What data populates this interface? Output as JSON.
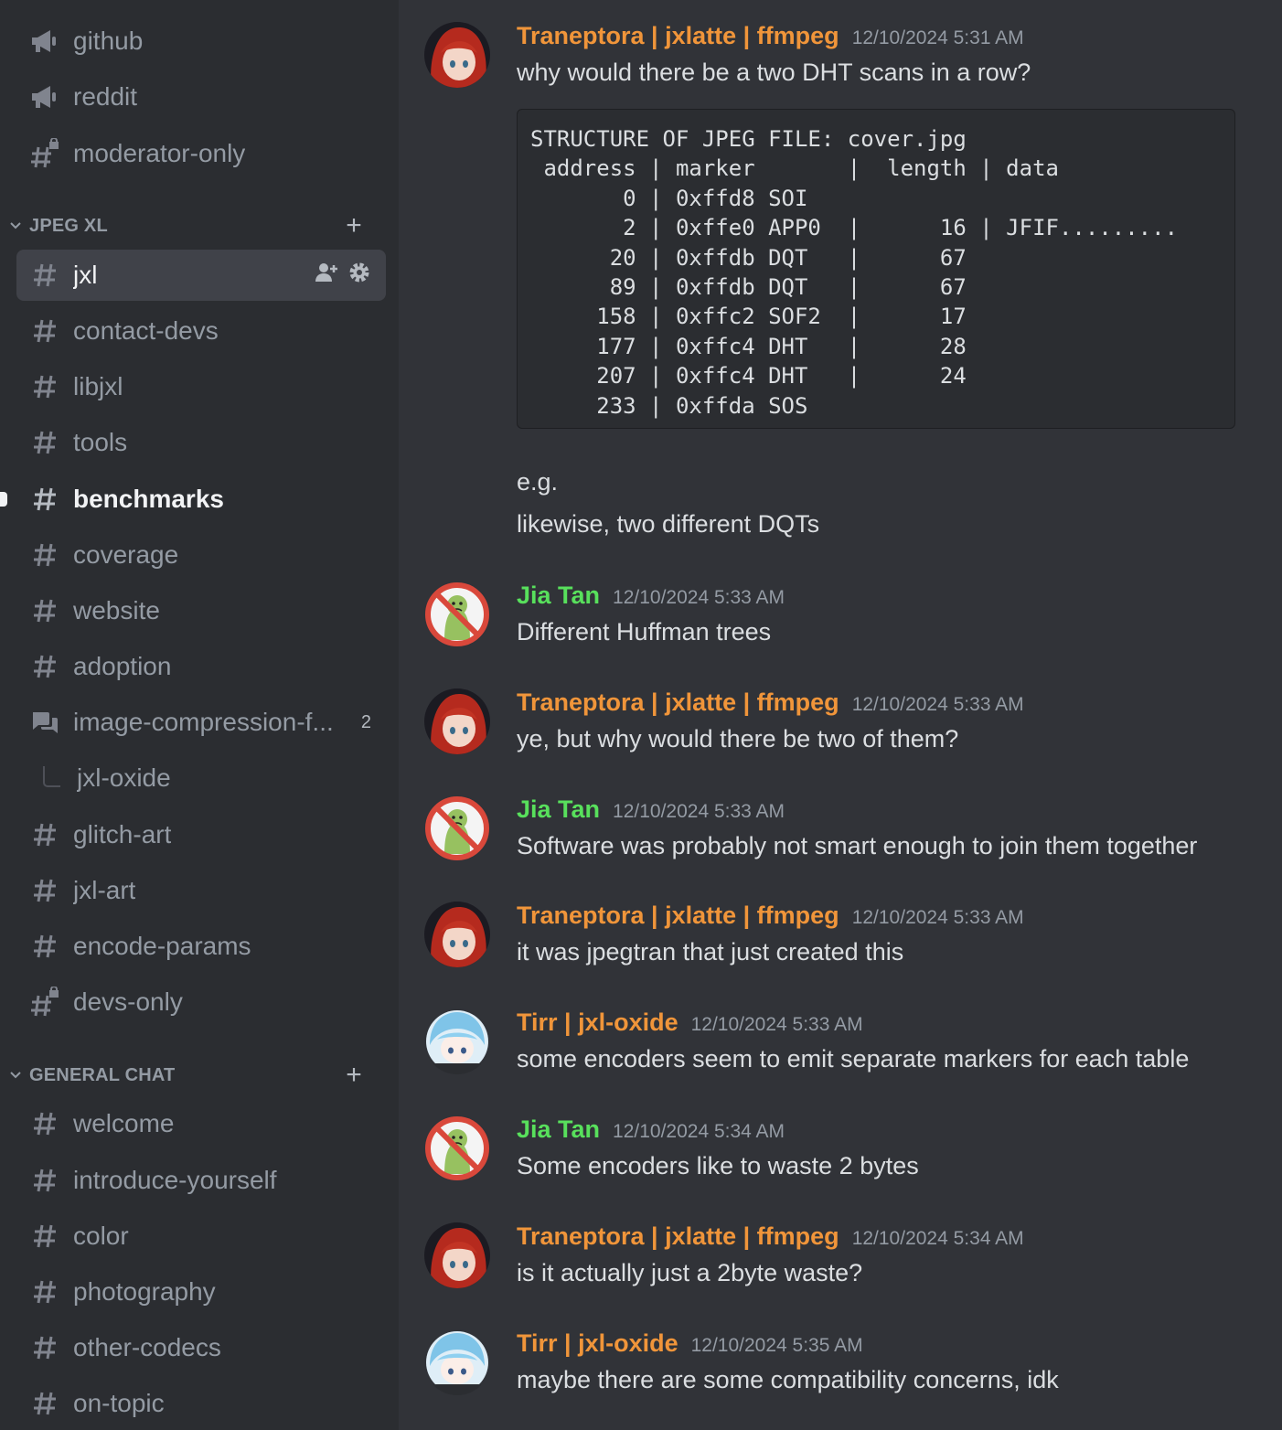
{
  "sidebar": {
    "top_channels": [
      {
        "label": "github",
        "icon": "megaphone-icon"
      },
      {
        "label": "reddit",
        "icon": "megaphone-icon"
      },
      {
        "label": "moderator-only",
        "icon": "locked-hash-icon"
      }
    ],
    "categories": [
      {
        "name": "JPEG XL",
        "channels": [
          {
            "label": "jxl",
            "icon": "hash-icon",
            "selected": true
          },
          {
            "label": "contact-devs",
            "icon": "hash-icon"
          },
          {
            "label": "libjxl",
            "icon": "hash-icon"
          },
          {
            "label": "tools",
            "icon": "hash-icon"
          },
          {
            "label": "benchmarks",
            "icon": "hash-icon",
            "unread": true
          },
          {
            "label": "coverage",
            "icon": "hash-icon"
          },
          {
            "label": "website",
            "icon": "hash-icon"
          },
          {
            "label": "adoption",
            "icon": "hash-icon"
          },
          {
            "label": "image-compression-f...",
            "icon": "forum-icon",
            "badge": "2"
          },
          {
            "label": "jxl-oxide",
            "icon": "thread-branch-icon"
          },
          {
            "label": "glitch-art",
            "icon": "hash-icon"
          },
          {
            "label": "jxl-art",
            "icon": "hash-icon"
          },
          {
            "label": "encode-params",
            "icon": "hash-icon"
          },
          {
            "label": "devs-only",
            "icon": "locked-hash-icon"
          }
        ]
      },
      {
        "name": "GENERAL CHAT",
        "channels": [
          {
            "label": "welcome",
            "icon": "hash-icon"
          },
          {
            "label": "introduce-yourself",
            "icon": "hash-icon"
          },
          {
            "label": "color",
            "icon": "hash-icon"
          },
          {
            "label": "photography",
            "icon": "hash-icon"
          },
          {
            "label": "other-codecs",
            "icon": "hash-icon"
          },
          {
            "label": "on-topic",
            "icon": "hash-icon"
          }
        ]
      }
    ]
  },
  "colors": {
    "username_orange": "#f0953a",
    "username_green": "#58e05c",
    "background": "#313338",
    "sidebar_background": "#2b2d31"
  },
  "messages": [
    {
      "author": "Traneptora | jxlatte | ffmpeg",
      "time": "12/10/2024 5:31 AM",
      "text": "why would there be a two DHT scans in a row?",
      "avatar": "red-haired-anime-avatar"
    },
    {
      "author": "Jia Tan",
      "time": "12/10/2024 5:33 AM",
      "text": "Different Huffman trees",
      "avatar": "no-symbol-frog-avatar"
    },
    {
      "author": "Traneptora | jxlatte | ffmpeg",
      "time": "12/10/2024 5:33 AM",
      "text": "ye, but why would there be two of them?",
      "avatar": "red-haired-anime-avatar"
    },
    {
      "author": "Jia Tan",
      "time": "12/10/2024 5:33 AM",
      "text": "Software was probably not smart enough to join them together",
      "avatar": "no-symbol-frog-avatar"
    },
    {
      "author": "Traneptora | jxlatte | ffmpeg",
      "time": "12/10/2024 5:33 AM",
      "text": "it was jpegtran that just created this",
      "avatar": "red-haired-anime-avatar"
    },
    {
      "author": "Tirr | jxl-oxide",
      "time": "12/10/2024 5:33 AM",
      "text": "some encoders seem to emit separate markers for each table",
      "avatar": "blue-haired-anime-avatar"
    },
    {
      "author": "Jia Tan",
      "time": "12/10/2024 5:34 AM",
      "text": "Some encoders like to waste 2 bytes",
      "avatar": "no-symbol-frog-avatar"
    },
    {
      "author": "Traneptora | jxlatte | ffmpeg",
      "time": "12/10/2024 5:34 AM",
      "text": "is it actually just a 2byte waste?",
      "avatar": "red-haired-anime-avatar"
    },
    {
      "author": "Tirr | jxl-oxide",
      "time": "12/10/2024 5:35 AM",
      "text": "maybe there are some compatibility concerns, idk",
      "avatar": "blue-haired-anime-avatar"
    }
  ],
  "code_block": "STRUCTURE OF JPEG FILE: cover.jpg\n address | marker       |  length | data\n       0 | 0xffd8 SOI\n       2 | 0xffe0 APP0  |      16 | JFIF.........\n      20 | 0xffdb DQT   |      67\n      89 | 0xffdb DQT   |      67\n     158 | 0xffc2 SOF2  |      17\n     177 | 0xffc4 DHT   |      28\n     207 | 0xffc4 DHT   |      24\n     233 | 0xffda SOS",
  "followups": [
    "e.g.",
    "likewise, two different DQTs"
  ]
}
